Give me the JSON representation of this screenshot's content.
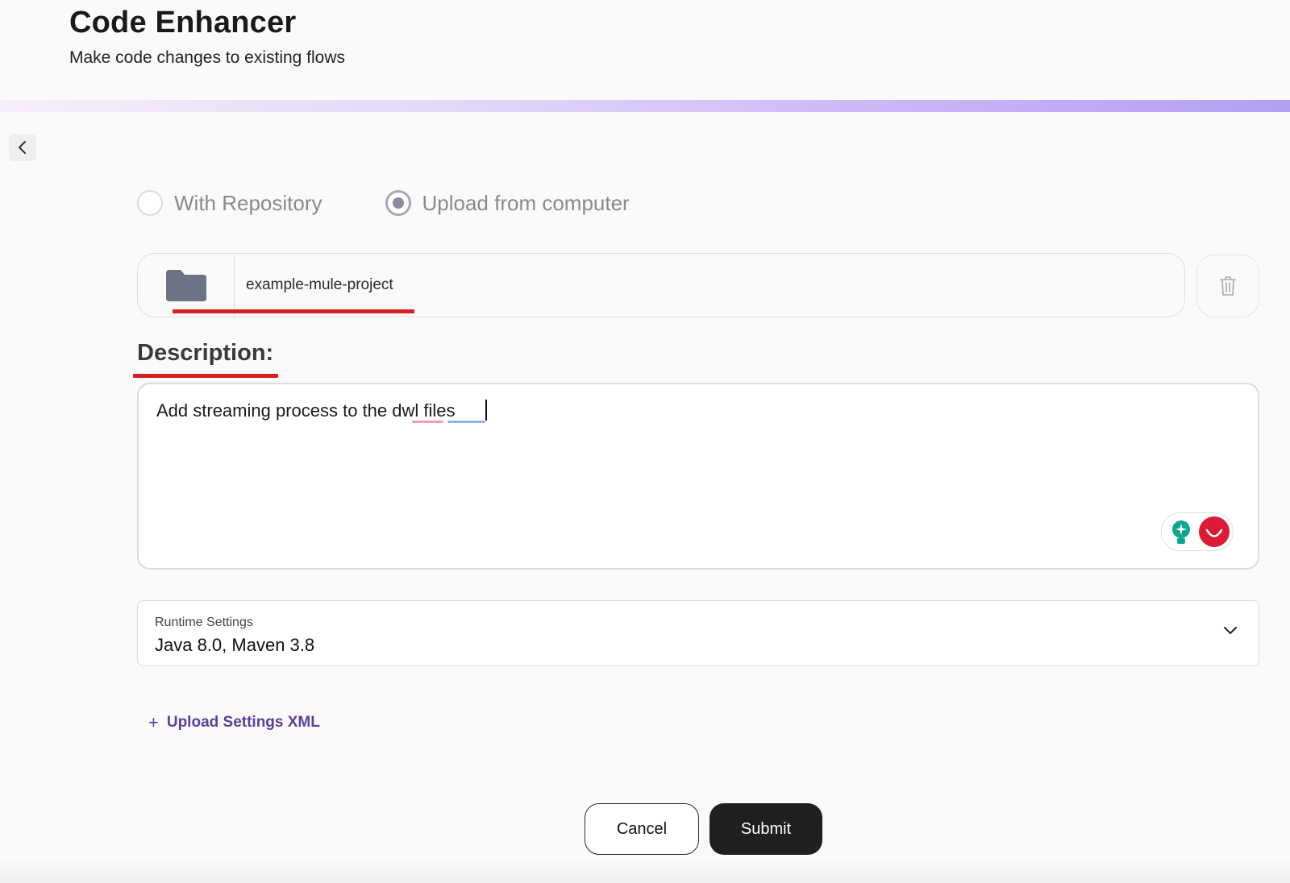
{
  "header": {
    "title": "Code Enhancer",
    "subtitle": "Make code changes to existing flows"
  },
  "source_options": [
    {
      "label": "With Repository",
      "selected": false
    },
    {
      "label": "Upload from computer",
      "selected": true
    }
  ],
  "file": {
    "name": "example-mule-project",
    "icon": "folder-icon"
  },
  "description": {
    "label": "Description:",
    "value": "Add streaming process to the dwl files"
  },
  "runtime": {
    "label": "Runtime Settings",
    "value": "Java 8.0, Maven 3.8"
  },
  "upload_settings": {
    "plus": "+",
    "label": "Upload Settings XML"
  },
  "actions": {
    "cancel_label": "Cancel",
    "submit_label": "Submit"
  },
  "colors": {
    "accent": "#5a3fa0",
    "annotation_underline": "#d61f1f",
    "submit_bg": "#1f1f1f"
  }
}
